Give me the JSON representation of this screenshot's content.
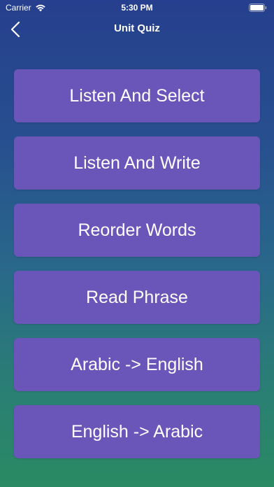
{
  "status_bar": {
    "carrier": "Carrier",
    "time": "5:30 PM"
  },
  "nav": {
    "title": "Unit Quiz",
    "back_icon": "chevron-left-icon"
  },
  "menu": {
    "items": [
      {
        "label": "Listen And Select"
      },
      {
        "label": "Listen And Write"
      },
      {
        "label": "Reorder Words"
      },
      {
        "label": "Read Phrase"
      },
      {
        "label": "Arabic -> English"
      },
      {
        "label": "English -> Arabic"
      }
    ]
  },
  "colors": {
    "button_background": "#6a56b8",
    "gradient_top": "#263f8e",
    "gradient_bottom": "#2a8a63",
    "text": "#ffffff"
  }
}
